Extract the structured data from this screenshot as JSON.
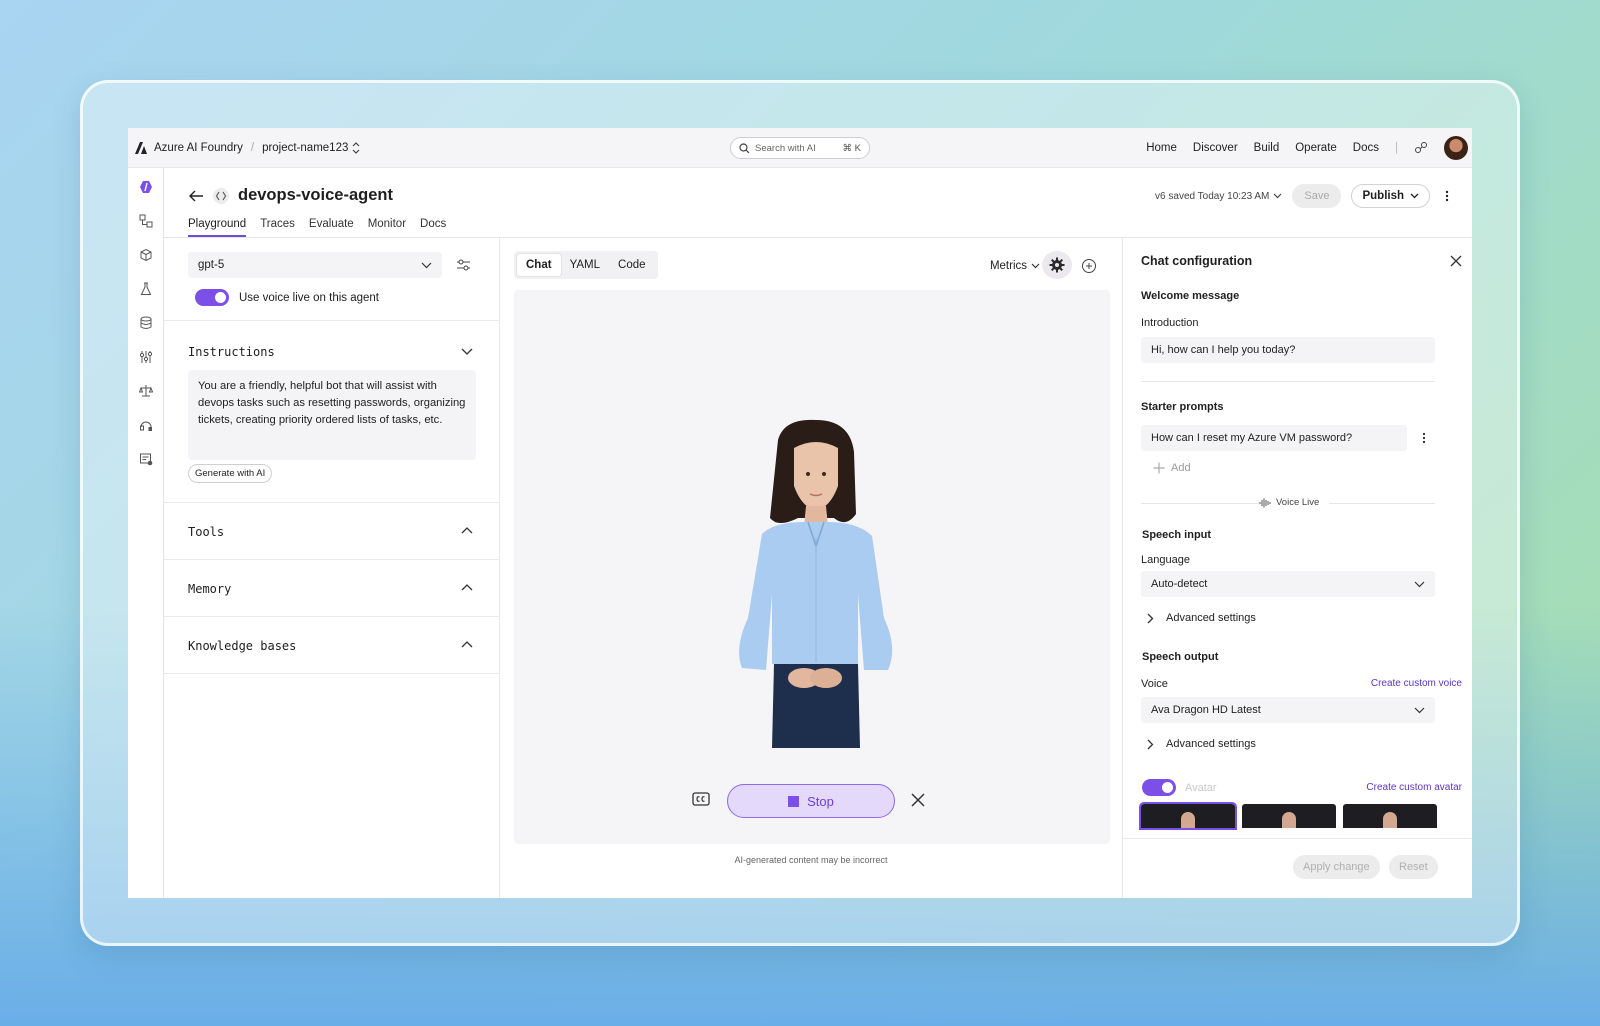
{
  "topbar": {
    "brand": "Azure AI Foundry",
    "project": "project-name123",
    "search_placeholder": "Search with AI",
    "search_shortcut": "⌘ K",
    "nav": [
      "Home",
      "Discover",
      "Build",
      "Operate",
      "Docs"
    ]
  },
  "header": {
    "title": "devops-voice-agent",
    "tabs": [
      "Playground",
      "Traces",
      "Evaluate",
      "Monitor",
      "Docs"
    ],
    "saved_status": "v6 saved Today 10:23 AM",
    "save_label": "Save",
    "publish_label": "Publish"
  },
  "left": {
    "model": "gpt-5",
    "voice_toggle_label": "Use voice live on this agent",
    "instructions_title": "Instructions",
    "instructions_text": "You are a friendly, helpful bot that will assist with devops tasks such as resetting passwords, organizing tickets, creating priority ordered lists of tasks, etc.",
    "generate_label": "Generate with AI",
    "tools_title": "Tools",
    "memory_title": "Memory",
    "knowledge_title": "Knowledge bases"
  },
  "center": {
    "tabs": [
      "Chat",
      "YAML",
      "Code"
    ],
    "metrics_label": "Metrics",
    "stop_label": "Stop",
    "disclaimer": "AI-generated content may be incorrect"
  },
  "right": {
    "title": "Chat configuration",
    "welcome_title": "Welcome message",
    "intro_label": "Introduction",
    "intro_value": "Hi, how can I help you today?",
    "starter_title": "Starter prompts",
    "starter_value": "How can I reset my  Azure VM password?",
    "add_label": "Add",
    "voice_live_label": "Voice Live",
    "speech_input_title": "Speech input",
    "language_label": "Language",
    "language_value": "Auto-detect",
    "advanced_label": "Advanced settings",
    "speech_output_title": "Speech output",
    "voice_label": "Voice",
    "create_voice_link": "Create custom voice",
    "voice_value": "Ava Dragon HD Latest",
    "avatar_label": "Avatar",
    "create_avatar_link": "Create custom avatar",
    "apply_label": "Apply change",
    "reset_label": "Reset"
  },
  "colors": {
    "accent": "#7b4fe8",
    "link": "#5a36c6"
  }
}
